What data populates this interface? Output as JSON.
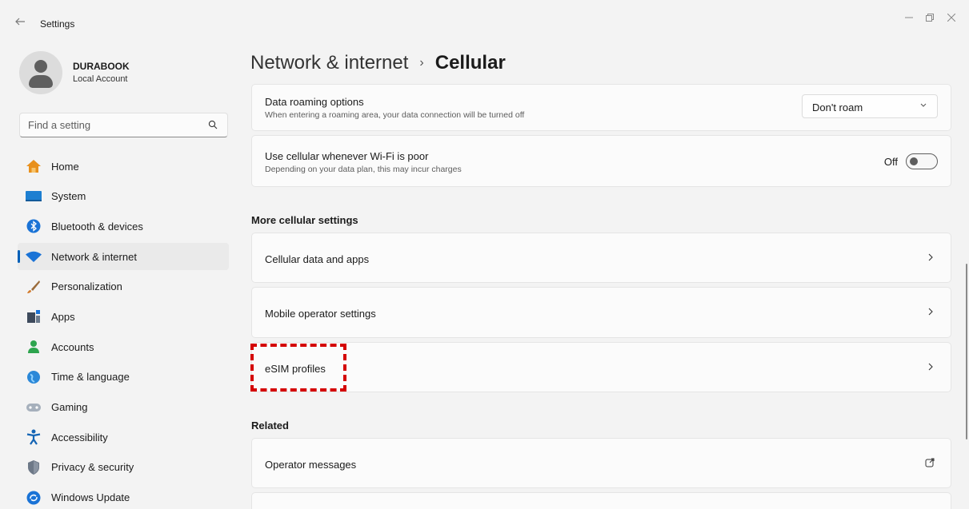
{
  "window": {
    "title": "Settings",
    "back_icon": "back-arrow-icon",
    "controls": [
      "minimize-icon",
      "maximize-icon",
      "close-icon"
    ]
  },
  "profile": {
    "name": "DURABOOK",
    "account_type": "Local Account"
  },
  "search": {
    "placeholder": "Find a setting",
    "value": ""
  },
  "sidebar": {
    "items": [
      {
        "label": "Home",
        "icon": "home-icon",
        "active": false
      },
      {
        "label": "System",
        "icon": "system-icon",
        "active": false
      },
      {
        "label": "Bluetooth & devices",
        "icon": "bluetooth-icon",
        "active": false
      },
      {
        "label": "Network & internet",
        "icon": "wifi-icon",
        "active": true
      },
      {
        "label": "Personalization",
        "icon": "brush-icon",
        "active": false
      },
      {
        "label": "Apps",
        "icon": "apps-icon",
        "active": false
      },
      {
        "label": "Accounts",
        "icon": "accounts-icon",
        "active": false
      },
      {
        "label": "Time & language",
        "icon": "globe-icon",
        "active": false
      },
      {
        "label": "Gaming",
        "icon": "gamepad-icon",
        "active": false
      },
      {
        "label": "Accessibility",
        "icon": "accessibility-icon",
        "active": false
      },
      {
        "label": "Privacy & security",
        "icon": "shield-icon",
        "active": false
      },
      {
        "label": "Windows Update",
        "icon": "update-icon",
        "active": false
      }
    ]
  },
  "breadcrumb": {
    "parent": "Network & internet",
    "separator": "›",
    "current": "Cellular"
  },
  "settings": {
    "data_roaming": {
      "title": "Data roaming options",
      "description": "When entering a roaming area, your data connection will be turned off",
      "selected": "Don't roam"
    },
    "wifi_poor": {
      "title": "Use cellular whenever Wi-Fi is poor",
      "description": "Depending on your data plan, this may incur charges",
      "state_label": "Off",
      "enabled": false
    }
  },
  "more_cellular": {
    "header": "More cellular settings",
    "items": [
      {
        "label": "Cellular data and apps"
      },
      {
        "label": "Mobile operator settings"
      },
      {
        "label": "eSIM profiles"
      }
    ]
  },
  "related": {
    "header": "Related",
    "items": [
      {
        "label": "Operator messages",
        "icon": "external-link-icon"
      }
    ]
  },
  "colors": {
    "accent": "#005fb8",
    "highlight": "#d40000"
  }
}
